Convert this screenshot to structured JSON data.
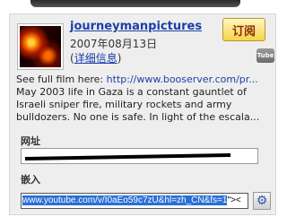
{
  "channel": {
    "name": "journeymanpictures",
    "date": "2007年08月13日",
    "details_open": "(",
    "details_label": "详细信息",
    "details_close": ")"
  },
  "subscribe": {
    "label": "订阅"
  },
  "tube_badge": {
    "label": "Tube"
  },
  "description": {
    "prefix": "See full film here: ",
    "link": "http://www.booserver.com/pr...",
    "text": " May 2003 life in Gaza is a constant gauntlet of Israeli sniper fire, military rockets and army bulldozers. No one is safe. In light of the escala..."
  },
  "url_field": {
    "label": "网址"
  },
  "embed_field": {
    "label": "嵌入",
    "selected_text": "www.youtube.com/v/I0aEo59c7zU&hl=zh_CN&fs=1",
    "tail_text": "\"><"
  },
  "colors": {
    "accent_link": "#1c3fa8",
    "subscribe_bg": "#f5d548",
    "selection": "#2a6fd6"
  },
  "icons": {
    "settings": "gear-icon",
    "tube": "tube-icon"
  }
}
